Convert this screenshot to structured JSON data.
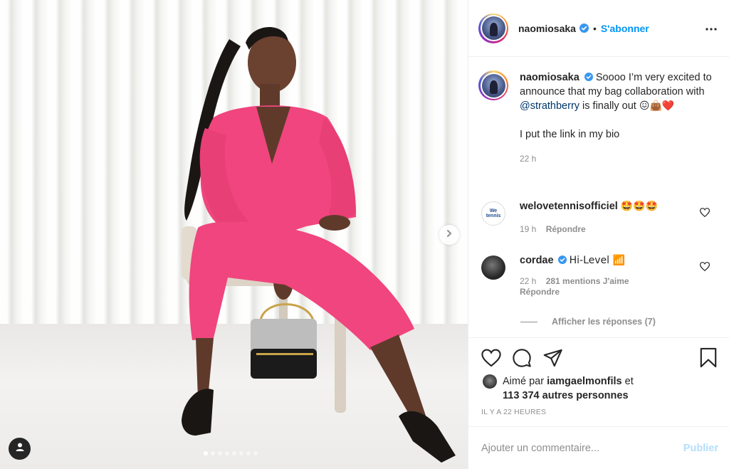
{
  "post": {
    "photo": {
      "carousel_dots": 8,
      "active_dot": 0,
      "icons": {
        "next": "chevron-right-icon",
        "user_tag": "user-icon"
      }
    },
    "header": {
      "username": "naomiosaka",
      "separator": "•",
      "follow_label": "S'abonner",
      "icons": {
        "verified": "verified-badge-icon",
        "more": "more-options-icon"
      }
    },
    "caption": {
      "username": "naomiosaka",
      "text_before_mention": "Soooo I’m very excited to announce that my bag collaboration with ",
      "mention": "@strathberry",
      "text_after_mention": " is finally out ",
      "emojis": "😖👜❤️",
      "second_paragraph": "I put the link in my bio",
      "time": "22 h"
    },
    "comments": [
      {
        "username": "welovetennisofficiel",
        "avatar_text": "We tennis",
        "text": "🤩🤩🤩",
        "time": "19 h",
        "reply_label": "Répondre",
        "likes": ""
      },
      {
        "username": "cordae",
        "text": "Hi-Level 📶",
        "time": "22 h",
        "likes": "281 mentions J'aime",
        "reply_label": "Répondre"
      }
    ],
    "view_replies": "Afficher les réponses (7)",
    "actions": {
      "icons": [
        "heart-icon",
        "comment-icon",
        "share-icon",
        "bookmark-icon"
      ]
    },
    "liked_by": {
      "prefix": "Aimé par ",
      "user": "iamgaelmonfils",
      "conjunction": " et",
      "others": "113 374 autres personnes"
    },
    "posted": "Il y a 22 heures",
    "add_comment": {
      "placeholder": "Ajouter un commentaire...",
      "publish_label": "Publier"
    }
  },
  "colors": {
    "accent": "#0095f6",
    "publish_disabled": "#b2dffc",
    "suit_pink": "#f0457e",
    "text": "#262626",
    "muted": "#8e8e8e"
  }
}
